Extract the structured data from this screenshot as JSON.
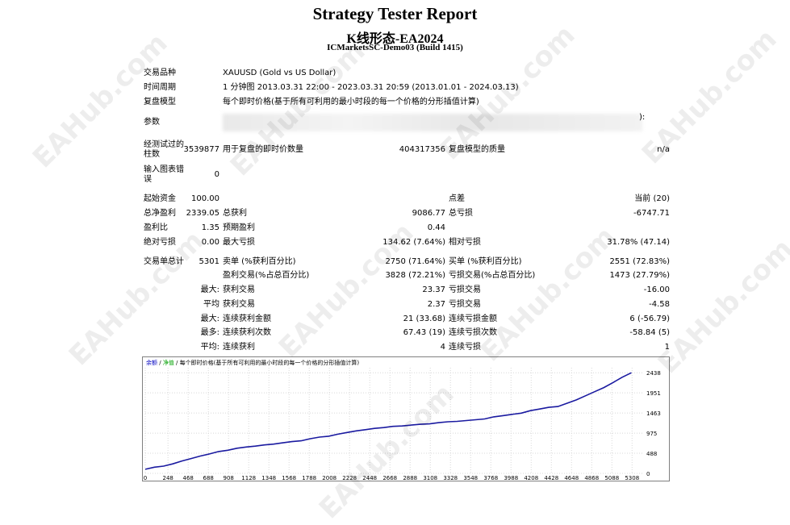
{
  "report": {
    "title": "Strategy Tester Report",
    "ea_name": "K线形态-EA2024",
    "server": "ICMarketsSC-Demo03 (Build 1415)"
  },
  "info": {
    "symbol_label": "交易品种",
    "symbol_value": "XAUUSD (Gold vs US Dollar)",
    "period_label": "时间周期",
    "period_value": "1 分钟图 2013.03.31 22:00 - 2023.03.31 20:59 (2013.01.01 - 2024.03.13)",
    "model_label": "复盘模型",
    "model_value": "每个即时价格(基于所有可利用的最小时段的每一个价格的分形插值计算)",
    "params_label": "参数",
    "params_tail": "):",
    "bars_label": "经测试过的柱数",
    "bars_value": "3539877",
    "ticks_label": "用于复盘的即时价数量",
    "ticks_value": "404317356",
    "quality_label": "复盘模型的质量",
    "quality_value": "n/a",
    "errors_label": "输入图表错误",
    "errors_value": "0"
  },
  "stats": {
    "deposit_label": "起始资金",
    "deposit_value": "100.00",
    "spread_label": "点差",
    "spread_value": "当前 (20)",
    "net_label": "总净盈利",
    "net_value": "2339.05",
    "gross_profit_label": "总获利",
    "gross_profit_value": "9086.77",
    "gross_loss_label": "总亏损",
    "gross_loss_value": "-6747.71",
    "pf_label": "盈利比",
    "pf_value": "1.35",
    "payoff_label": "预期盈利",
    "payoff_value": "0.44",
    "abs_dd_label": "绝对亏损",
    "abs_dd_value": "0.00",
    "max_dd_label": "最大亏损",
    "max_dd_value": "134.62 (7.64%)",
    "rel_dd_label": "相对亏损",
    "rel_dd_value": "31.78% (47.14)",
    "total_trades_label": "交易单总计",
    "total_trades_value": "5301",
    "short_label": "卖单 (%获利百分比)",
    "short_value": "2750 (71.64%)",
    "long_label": "买单 (%获利百分比)",
    "long_value": "2551 (72.83%)",
    "profit_trades_label": "盈利交易(%占总百分比)",
    "profit_trades_value": "3828 (72.21%)",
    "loss_trades_label": "亏损交易(%占总百分比)",
    "loss_trades_value": "1473 (27.79%)",
    "largest": "最大:",
    "largest_profit_label": "获利交易",
    "largest_profit_value": "23.37",
    "largest_loss_label": "亏损交易",
    "largest_loss_value": "-16.00",
    "average": "平均",
    "avg_profit_label": "获利交易",
    "avg_profit_value": "2.37",
    "avg_loss_label": "亏损交易",
    "avg_loss_value": "-4.58",
    "max_label": "最大:",
    "max_cons_wins_label": "连续获利金额",
    "max_cons_wins_value": "21 (33.68)",
    "max_cons_losses_label": "连续亏损金额",
    "max_cons_losses_value": "6 (-56.79)",
    "most_label": "最多:",
    "max_cons_profit_label": "连续获利次数",
    "max_cons_profit_value": "67.43 (19)",
    "max_cons_loss_label": "连续亏损次数",
    "max_cons_loss_value": "-58.84 (5)",
    "avg2_label": "平均:",
    "avg_cons_wins_label": "连续获利",
    "avg_cons_wins_value": "4",
    "avg_cons_losses_label": "连续亏损",
    "avg_cons_losses_value": "1"
  },
  "watermark": "EAHub.com",
  "chart_data": {
    "type": "line",
    "legend_balance": "余额",
    "legend_sep1": " / ",
    "legend_equity": "净值",
    "legend_rest": " / 每个即时价格(基于所有可利用的最小时段的每一个价格的分形插值计算)",
    "yticks": [
      0,
      488,
      975,
      1463,
      1951,
      2438
    ],
    "xticks": [
      0,
      248,
      468,
      688,
      908,
      1128,
      1348,
      1568,
      1788,
      2008,
      2228,
      2448,
      2668,
      2888,
      3108,
      3328,
      3548,
      3768,
      3988,
      4208,
      4428,
      4648,
      4868,
      5088,
      5308
    ],
    "ylim": [
      0,
      2560
    ],
    "xlim": [
      0,
      5420
    ],
    "series": [
      {
        "values_x": [
          0,
          100,
          200,
          300,
          400,
          500,
          600,
          700,
          800,
          900,
          1000,
          1100,
          1200,
          1300,
          1400,
          1500,
          1600,
          1700,
          1800,
          1900,
          2000,
          2100,
          2200,
          2300,
          2400,
          2500,
          2600,
          2700,
          2800,
          2900,
          3000,
          3100,
          3200,
          3300,
          3400,
          3500,
          3600,
          3700,
          3800,
          3900,
          4000,
          4100,
          4200,
          4300,
          4400,
          4500,
          4600,
          4700,
          4800,
          4900,
          5000,
          5100,
          5200,
          5301
        ],
        "values_y": [
          100,
          150,
          175,
          230,
          300,
          360,
          420,
          470,
          530,
          560,
          610,
          640,
          660,
          690,
          710,
          740,
          770,
          790,
          840,
          880,
          900,
          950,
          990,
          1030,
          1060,
          1090,
          1110,
          1140,
          1150,
          1170,
          1190,
          1200,
          1230,
          1250,
          1260,
          1280,
          1300,
          1320,
          1370,
          1400,
          1430,
          1460,
          1520,
          1560,
          1600,
          1620,
          1700,
          1780,
          1880,
          1980,
          2080,
          2200,
          2330,
          2439
        ]
      }
    ]
  }
}
